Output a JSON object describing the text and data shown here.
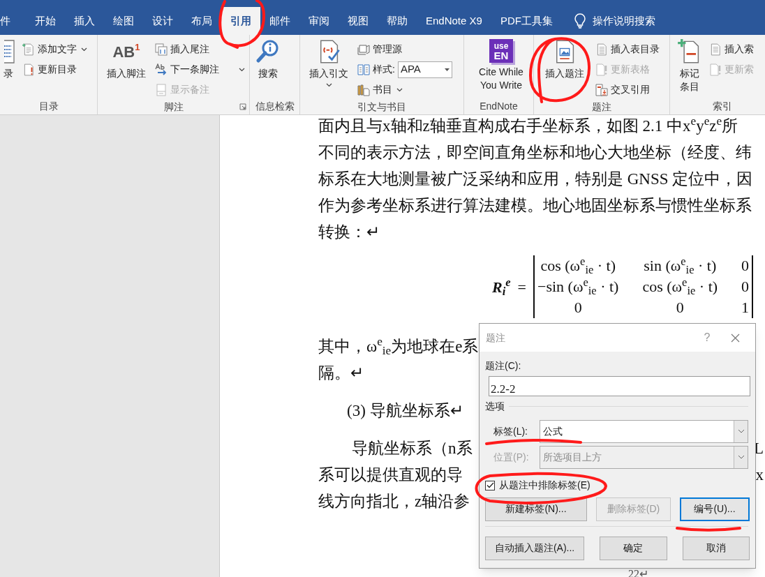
{
  "tabs": [
    {
      "label": "件",
      "selected": false
    },
    {
      "label": "开始",
      "selected": false
    },
    {
      "label": "插入",
      "selected": false
    },
    {
      "label": "绘图",
      "selected": false
    },
    {
      "label": "设计",
      "selected": false
    },
    {
      "label": "布局",
      "selected": false
    },
    {
      "label": "引用",
      "selected": true
    },
    {
      "label": "邮件",
      "selected": false
    },
    {
      "label": "审阅",
      "selected": false
    },
    {
      "label": "视图",
      "selected": false
    },
    {
      "label": "帮助",
      "selected": false
    },
    {
      "label": "EndNote X9",
      "selected": false
    },
    {
      "label": "PDF工具集",
      "selected": false
    }
  ],
  "tell_me": "操作说明搜索",
  "ribbon": [
    {
      "label": "目录",
      "launcher": false,
      "columns": [
        {
          "kind": "large",
          "label": "录",
          "menu": false,
          "disabled": false
        },
        {
          "kind": "stack",
          "items": [
            {
              "kind": "button",
              "label": "添加文字",
              "menu": true,
              "disabled": false
            },
            {
              "kind": "button",
              "label": "更新目录",
              "menu": false,
              "disabled": false
            }
          ]
        }
      ]
    },
    {
      "label": "脚注",
      "launcher": true,
      "columns": [
        {
          "kind": "large",
          "label": "插入脚注",
          "icon_lines": [
            "AB$^{1}$"
          ],
          "menu": false,
          "disabled": false
        },
        {
          "kind": "stack",
          "items": [
            {
              "kind": "button",
              "label": "插入尾注",
              "menu": false,
              "disabled": false
            },
            {
              "kind": "button",
              "label": "下一条脚注",
              "menu": true,
              "disabled": false
            },
            {
              "kind": "button",
              "label": "显示备注",
              "menu": false,
              "disabled": true
            }
          ]
        }
      ]
    },
    {
      "label": "信息检索",
      "launcher": false,
      "columns": [
        {
          "kind": "large",
          "label": "搜索",
          "menu": false,
          "disabled": false
        }
      ]
    },
    {
      "label": "引文与书目",
      "launcher": false,
      "columns": [
        {
          "kind": "large",
          "label": "插入引文",
          "menu": true,
          "disabled": false
        },
        {
          "kind": "stack",
          "items": [
            {
              "kind": "button",
              "label": "管理源",
              "menu": false,
              "disabled": false
            },
            {
              "kind": "select",
              "label": "样式:",
              "value": "APA",
              "menu": true,
              "disabled": false
            },
            {
              "kind": "button",
              "label": "书目",
              "menu": true,
              "disabled": false
            }
          ]
        }
      ]
    },
    {
      "label": "EndNote",
      "launcher": false,
      "columns": [
        {
          "kind": "large",
          "label": "Cite While You Write",
          "icon_lines": [
            "use",
            "EN"
          ],
          "menu": false,
          "disabled": false
        }
      ]
    },
    {
      "label": "题注",
      "launcher": false,
      "columns": [
        {
          "kind": "large",
          "label": "插入题注",
          "menu": false,
          "disabled": false
        },
        {
          "kind": "stack",
          "items": [
            {
              "kind": "button",
              "label": "插入表目录",
              "menu": false,
              "disabled": false
            },
            {
              "kind": "button",
              "label": "更新表格",
              "menu": false,
              "disabled": true
            },
            {
              "kind": "button",
              "label": "交叉引用",
              "menu": false,
              "disabled": false
            }
          ]
        }
      ]
    },
    {
      "label": "索引",
      "launcher": false,
      "columns": [
        {
          "kind": "large",
          "label": "标记条目",
          "menu": false,
          "disabled": false
        },
        {
          "kind": "stack",
          "items": [
            {
              "kind": "button",
              "label": "插入索",
              "menu": false,
              "disabled": false
            },
            {
              "kind": "button",
              "label": "更新索",
              "menu": false,
              "disabled": true
            }
          ]
        }
      ]
    }
  ],
  "document": {
    "blocks": [
      {
        "kind": "text",
        "text": "面内且与x轴和z轴垂直构成右手坐标系，如图 2.1 中x$^{e}$y$^{e}$z$^{e}$所"
      },
      {
        "kind": "text",
        "text": "不同的表示方法，即空间直角坐标和地心大地坐标（经度、纬"
      },
      {
        "kind": "text",
        "text": "标系在大地测量被广泛采纳和应用，特别是 GNSS 定位中，因"
      },
      {
        "kind": "text",
        "text": "作为参考坐标系进行算法建模。地心地固坐标系与惯性坐标系"
      },
      {
        "kind": "text",
        "text": "转换：↵"
      },
      {
        "kind": "equation",
        "lhs": "R$_{i}$$^{e}$",
        "sign": "=",
        "rows": [
          [
            "cos (ω$^{e}$$_{ie}$ · t)",
            "sin (ω$^{e}$$_{ie}$ · t)",
            "0"
          ],
          [
            "−sin (ω$^{e}$$_{ie}$ · t)",
            "cos (ω$^{e}$$_{ie}$ · t)",
            "0"
          ],
          [
            "0",
            "0",
            "1"
          ]
        ]
      },
      {
        "kind": "text",
        "text": "其中，ω$^{e}$$_{ie}$为地球在e系"
      },
      {
        "kind": "text",
        "text": "隔。↵"
      },
      {
        "kind": "heading",
        "text": "(3)  导航坐标系↵"
      },
      {
        "kind": "first-line",
        "text": "导航坐标系（n系",
        "right": "L"
      },
      {
        "kind": "text",
        "text": "系可以提供直观的导",
        "right": "x"
      },
      {
        "kind": "text",
        "text": "线方向指北，z轴沿参"
      }
    ],
    "page_number": "22↵"
  },
  "dialog": {
    "title": "题注",
    "help": "?",
    "caption_label": "题注(C):",
    "caption_value": "2.2-2",
    "options_heading": "选项",
    "fields": [
      {
        "label": "标签(L):",
        "value": "公式",
        "disabled": false
      },
      {
        "label": "位置(P):",
        "value": "所选项目上方",
        "disabled": true
      }
    ],
    "exclude": {
      "label": "从题注中排除标签(E)",
      "checked": true
    },
    "buttons": [
      {
        "label": "新建标签(N)...",
        "disabled": false,
        "focused": false
      },
      {
        "label": "删除标签(D)",
        "disabled": true,
        "focused": false
      },
      {
        "label": "编号(U)...",
        "disabled": false,
        "focused": true
      }
    ],
    "footer_buttons": [
      {
        "label": "自动插入题注(A)..."
      },
      {
        "label": "确定"
      },
      {
        "label": "取消"
      }
    ]
  }
}
